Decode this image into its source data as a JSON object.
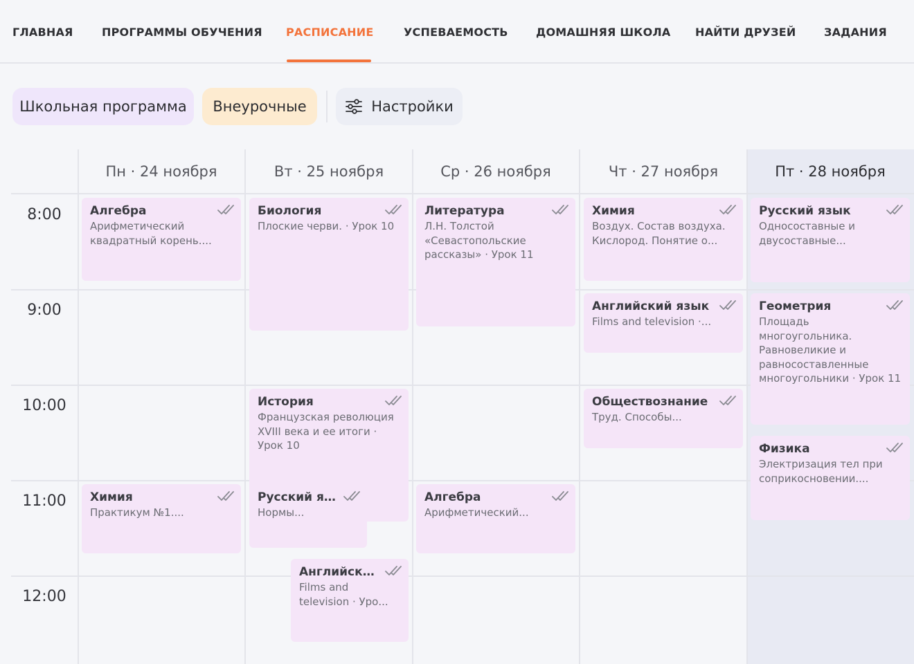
{
  "nav": {
    "items": [
      {
        "label": "ГЛАВНАЯ"
      },
      {
        "label": "ПРОГРАММЫ ОБУЧЕНИЯ"
      },
      {
        "label": "РАСПИСАНИЕ"
      },
      {
        "label": "УСПЕВАЕМОСТЬ"
      },
      {
        "label": "ДОМАШНЯЯ ШКОЛА"
      },
      {
        "label": "НАЙТИ ДРУЗЕЙ"
      },
      {
        "label": "ЗАДАНИЯ"
      }
    ],
    "active_index": 2,
    "accent_color": "#f3733b"
  },
  "filters": {
    "school": "Школьная программа",
    "extra": "Внеурочные",
    "settings": "Настройки",
    "settings_icon": "sliders-icon"
  },
  "calendar": {
    "days": [
      {
        "label": "Пн · 24 ноября"
      },
      {
        "label": "Вт · 25 ноября"
      },
      {
        "label": "Ср · 26 ноября"
      },
      {
        "label": "Чт · 27 ноября"
      },
      {
        "label": "Пт · 28 ноября",
        "today": true
      }
    ],
    "times": [
      "8:00",
      "9:00",
      "10:00",
      "11:00",
      "12:00"
    ],
    "lessons": [
      {
        "subject": "Алгебра",
        "topic": "Арифметический квадратный корень...."
      },
      {
        "subject": "Биология",
        "topic": "Плоские черви. · Урок 10"
      },
      {
        "subject": "Литература",
        "topic": "Л.Н. Толстой «Севастопольские рассказы» · Урок 11"
      },
      {
        "subject": "Химия",
        "topic": "Воздух. Состав воздуха. Кислород. Понятие о..."
      },
      {
        "subject": "Русский язык",
        "topic": "Односоставные и двусоставные..."
      },
      {
        "subject": "Английский язык",
        "topic": "Films and television ·..."
      },
      {
        "subject": "Геометрия",
        "topic": "Площадь многоугольника. Равновеликие и равносоставленные многоугольники · Урок 11"
      },
      {
        "subject": "История",
        "topic": "Французская революция XVIII века и ее итоги · Урок 10"
      },
      {
        "subject": "Обществознание",
        "topic": "Труд. Способы..."
      },
      {
        "subject": "Физика",
        "topic": "Электризация тел при соприкосновении...."
      },
      {
        "subject": "Химия",
        "topic": "Практикум №1...."
      },
      {
        "subject": "Русский яз...",
        "topic": "Нормы..."
      },
      {
        "subject": "Алгебра",
        "topic": "Арифметический..."
      },
      {
        "subject": "Английски...",
        "topic": "Films and television · Уро..."
      }
    ],
    "card_color": "#f5e5f8",
    "today_color": "#e8eaf3"
  }
}
